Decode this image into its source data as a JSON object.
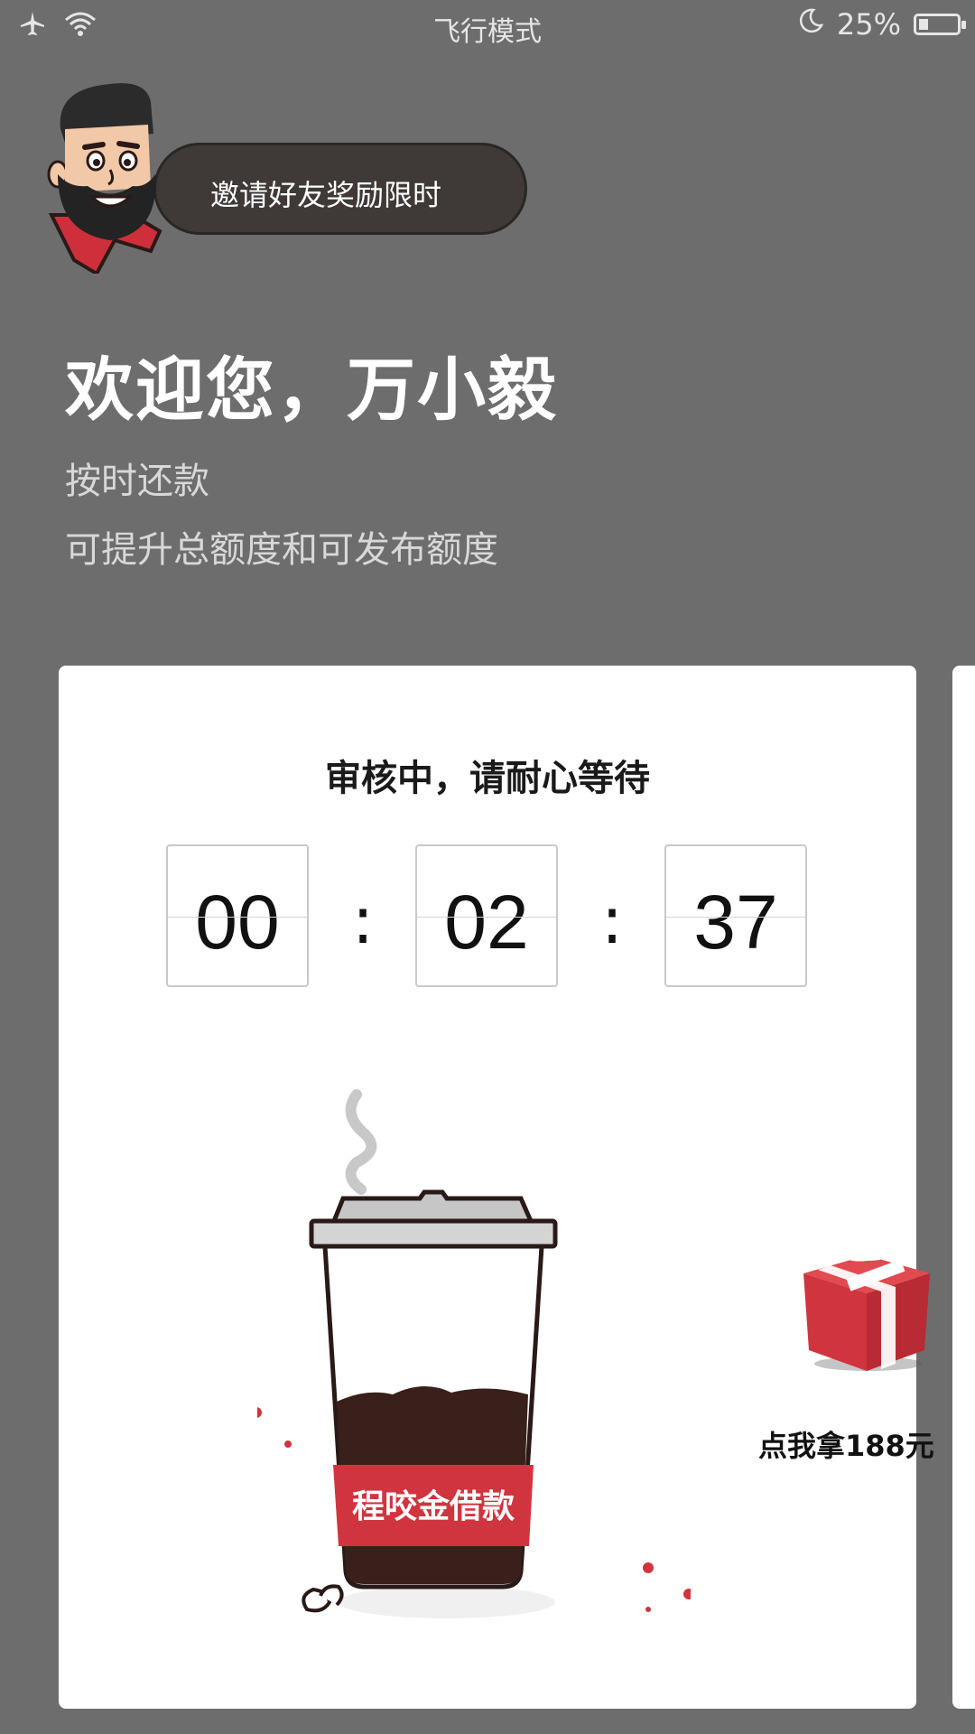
{
  "status_bar": {
    "title": "飞行模式",
    "battery_percent": "25%",
    "battery_level": 0.25,
    "icons": [
      "airplane-icon",
      "wifi-icon",
      "moon-icon",
      "battery-icon"
    ]
  },
  "invite_banner": {
    "text": "邀请好友奖励限时"
  },
  "greeting": {
    "title": "欢迎您，万小毅",
    "line1": "按时还款",
    "line2": "可提升总额度和可发布额度"
  },
  "review_card": {
    "title": "审核中，请耐心等待",
    "timer": {
      "hours": "00",
      "minutes": "02",
      "seconds": "37",
      "separator": ":"
    },
    "cup_label": "程咬金借款"
  },
  "gift": {
    "label": "点我拿188元"
  },
  "colors": {
    "background": "#6d6d6d",
    "card": "#ffffff",
    "accent_red": "#d0343f",
    "coffee": "#3a201a"
  }
}
